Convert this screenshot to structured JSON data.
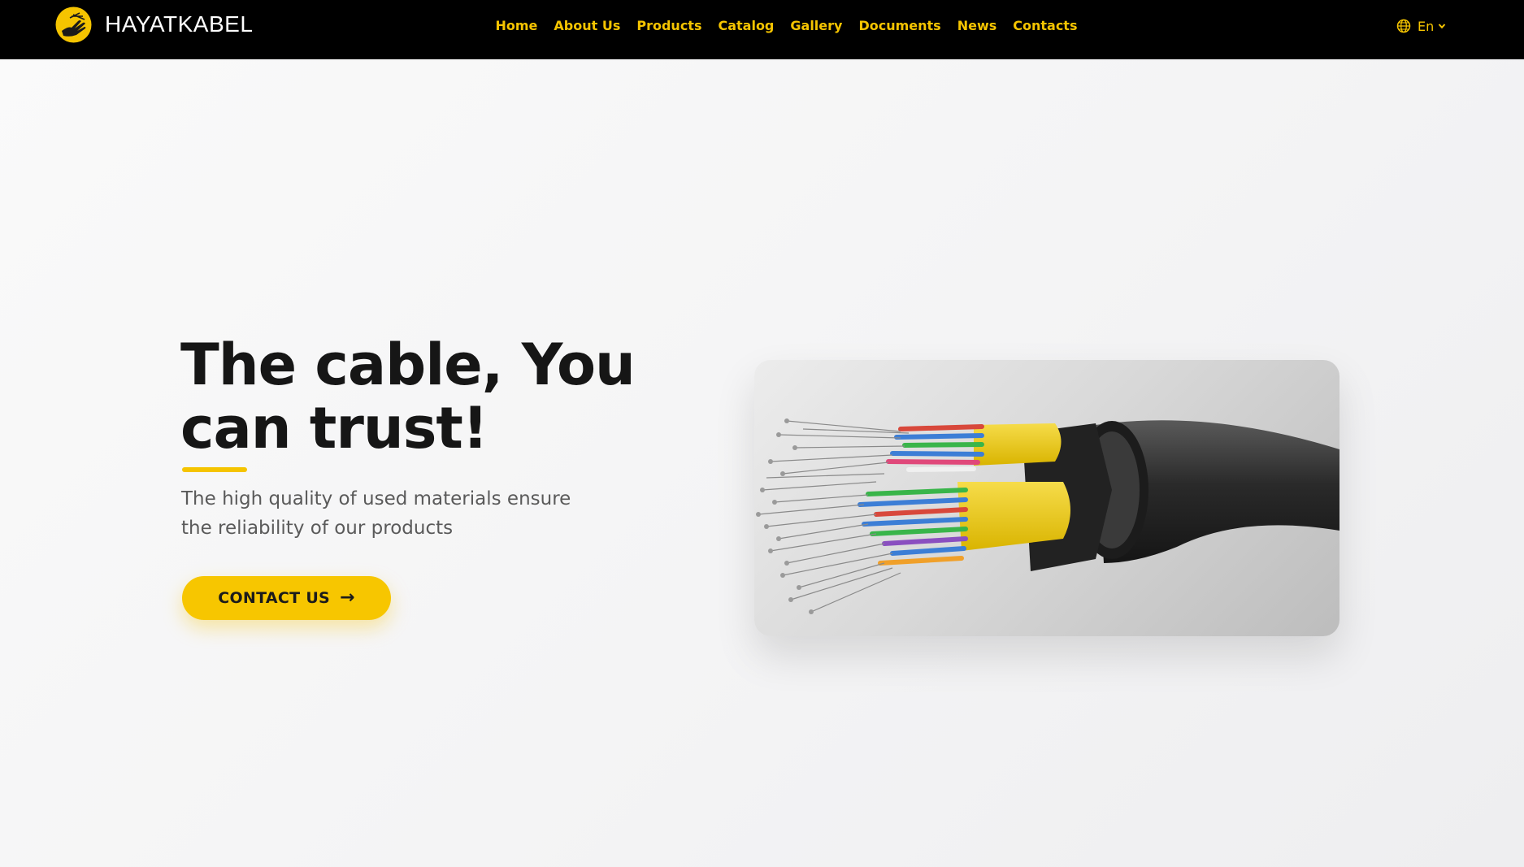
{
  "brand": {
    "name": "HAYATKABEL",
    "logo_icon": "hand-cable-icon",
    "accent": "#f5c400"
  },
  "nav": {
    "items": [
      {
        "label": "Home"
      },
      {
        "label": "About Us"
      },
      {
        "label": "Products"
      },
      {
        "label": "Catalog"
      },
      {
        "label": "Gallery"
      },
      {
        "label": "Documents"
      },
      {
        "label": "News"
      },
      {
        "label": "Contacts"
      }
    ]
  },
  "language": {
    "icon": "globe-icon",
    "label": "En"
  },
  "hero": {
    "title_line1": "The cable, You",
    "title_line2": "can trust!",
    "subtitle_line1": "The high quality of used materials ensure",
    "subtitle_line2": "the reliability of our products",
    "cta_label": "CONTACT US",
    "cta_arrow": "→",
    "image_icon": "fiber-optic-cable-image"
  }
}
